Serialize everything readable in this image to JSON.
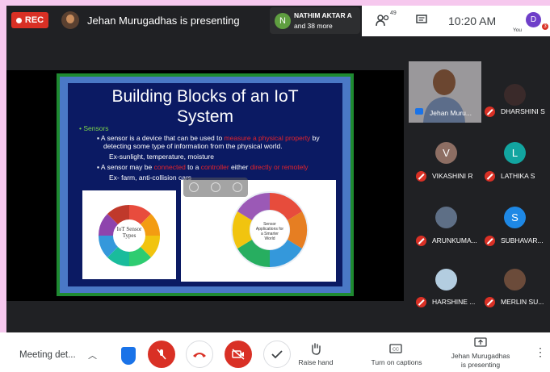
{
  "topbar": {
    "rec_label": "REC",
    "presenter_title": "Jehan Murugadhas is presenting",
    "join_name": "NATHIM AKTAR A",
    "join_more": "and 38 more",
    "people_count": "49",
    "clock": "10:20 AM",
    "you_initial": "D",
    "you_label": "You",
    "you_badge": "3"
  },
  "slide": {
    "title_line1": "Building Blocks of an IoT",
    "title_line2": "System",
    "section": "Sensors",
    "b1_pre": "A sensor is a device that can be used to ",
    "b1_hl": "measure a physical property",
    "b1_post": " by",
    "b1_line2": "detecting some type of information from the physical world.",
    "b1_ex": "Ex-sunlight, temperature, moisture",
    "b2_pre": "A sensor may be ",
    "b2_hl1": "connected",
    "b2_mid": " to a ",
    "b2_hl2": "controller",
    "b2_mid2": " either ",
    "b2_hl3": "directly or remotely",
    "b2_ex": "Ex- farm, anti-collision cars",
    "wheel_center": "IoT Sensor Types",
    "wheel_labels": [
      "Vision/Light",
      "Electromagnetic",
      "Motion/Speed",
      "Chemical",
      "Temperature",
      "Humidity",
      "Position/Presence",
      "Acoustic/Vibration"
    ],
    "app_center": "Sensor Applications for a Smarter World",
    "app_labels": [
      "Position/Proximity",
      "Chemical/Gas",
      "Acoustic/Sound",
      "Flow",
      "Ambient Light/Machine vision/Optical",
      "Humidity/Moisture/Water",
      "Motion/Velocity/Displacement",
      "Temperature",
      "Force/Load/Pressure",
      "Leaks/Levels",
      "Electric",
      "Magnetic",
      "Ultrasonic/Radar"
    ]
  },
  "participants": [
    {
      "name": "Jehan Muru...",
      "initial": "",
      "color": "#8c8a8d"
    },
    {
      "name": "DHARSHINI S",
      "initial": "",
      "color": "#3a2a2a"
    },
    {
      "name": "VIKASHINI R",
      "initial": "V",
      "color": "#8d6e63"
    },
    {
      "name": "LATHIKA S",
      "initial": "L",
      "color": "#12a5a0"
    },
    {
      "name": "ARUNKUMA...",
      "initial": "",
      "color": "#5e6f86"
    },
    {
      "name": "SUBHAVAR...",
      "initial": "S",
      "color": "#1e88e5"
    },
    {
      "name": "HARSHINE ...",
      "initial": "",
      "color": "#b3cde0"
    },
    {
      "name": "MERLIN SU...",
      "initial": "",
      "color": "#6b4b3a"
    }
  ],
  "bottombar": {
    "meeting_details": "Meeting det...",
    "raise_hand": "Raise hand",
    "captions": "Turn on captions",
    "presenting_line1": "Jehan Murugadhas",
    "presenting_line2": "is presenting"
  },
  "colors": {
    "danger": "#d93025",
    "bar": "#202124",
    "accent": "#1a73e8"
  }
}
